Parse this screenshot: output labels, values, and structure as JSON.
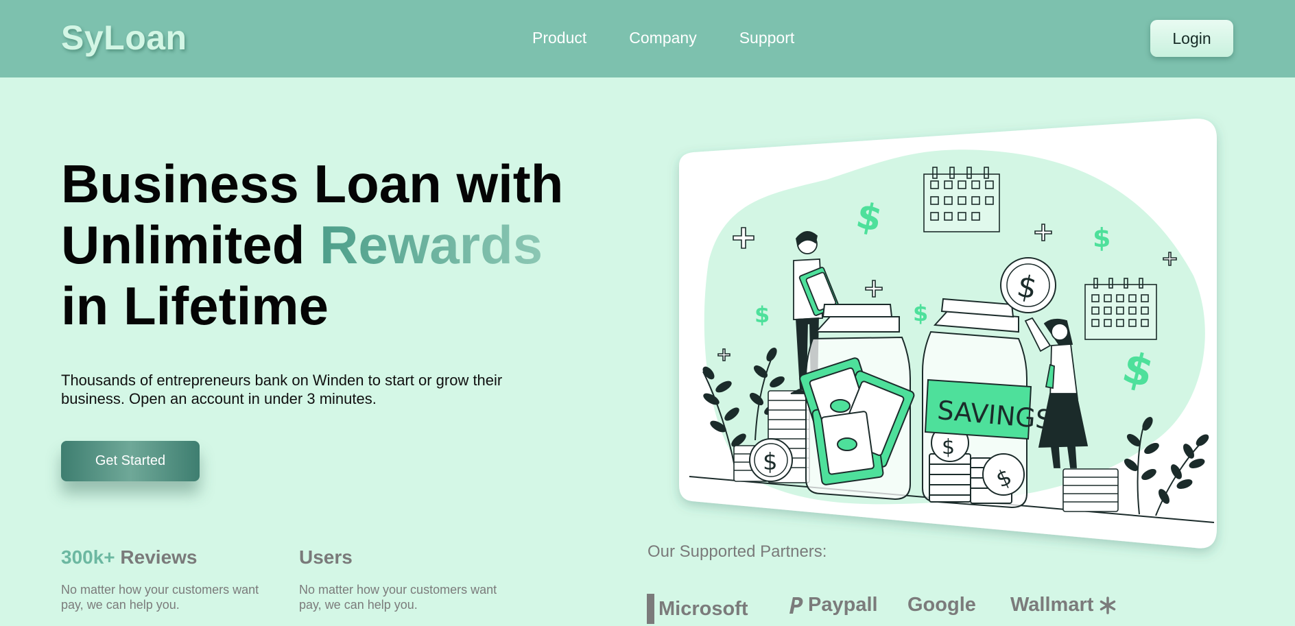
{
  "brand": {
    "name": "SyLoan"
  },
  "nav": {
    "links": [
      {
        "label": "Product"
      },
      {
        "label": "Company"
      },
      {
        "label": "Support"
      }
    ],
    "login_label": "Login"
  },
  "hero": {
    "title_line1": "Business Loan with",
    "title_line2_prefix": "Unlimited",
    "title_line2_accent": "Rewards",
    "title_line3": "in Lifetime",
    "subtitle": "Thousands of entrepreneurs bank on Winden to start or grow their business. Open an account in under 3 minutes.",
    "cta_label": "Get Started",
    "illustration_label": "SAVINGS"
  },
  "stats": [
    {
      "highlight": "300k+",
      "title": "Reviews",
      "description": "No matter how your customers want pay, we can help you."
    },
    {
      "highlight": "",
      "title": "Users",
      "description": "No matter how your customers want pay, we can help you."
    }
  ],
  "partners": {
    "label": "Our Supported Partners:",
    "items": [
      {
        "name": "Microsoft",
        "icon": "windows-logo-icon"
      },
      {
        "name": "Paypall",
        "icon": "paypal-logo-icon"
      },
      {
        "name": "Google",
        "icon": ""
      },
      {
        "name": "Wallmart",
        "icon": "walmart-spark-icon"
      }
    ]
  },
  "colors": {
    "navbar": "#7dc1ae",
    "page_background": "#d4f7e6",
    "accent": "#6cb8a1",
    "cta": "#4e8d7e",
    "illustration_green": "#4ee09b"
  }
}
